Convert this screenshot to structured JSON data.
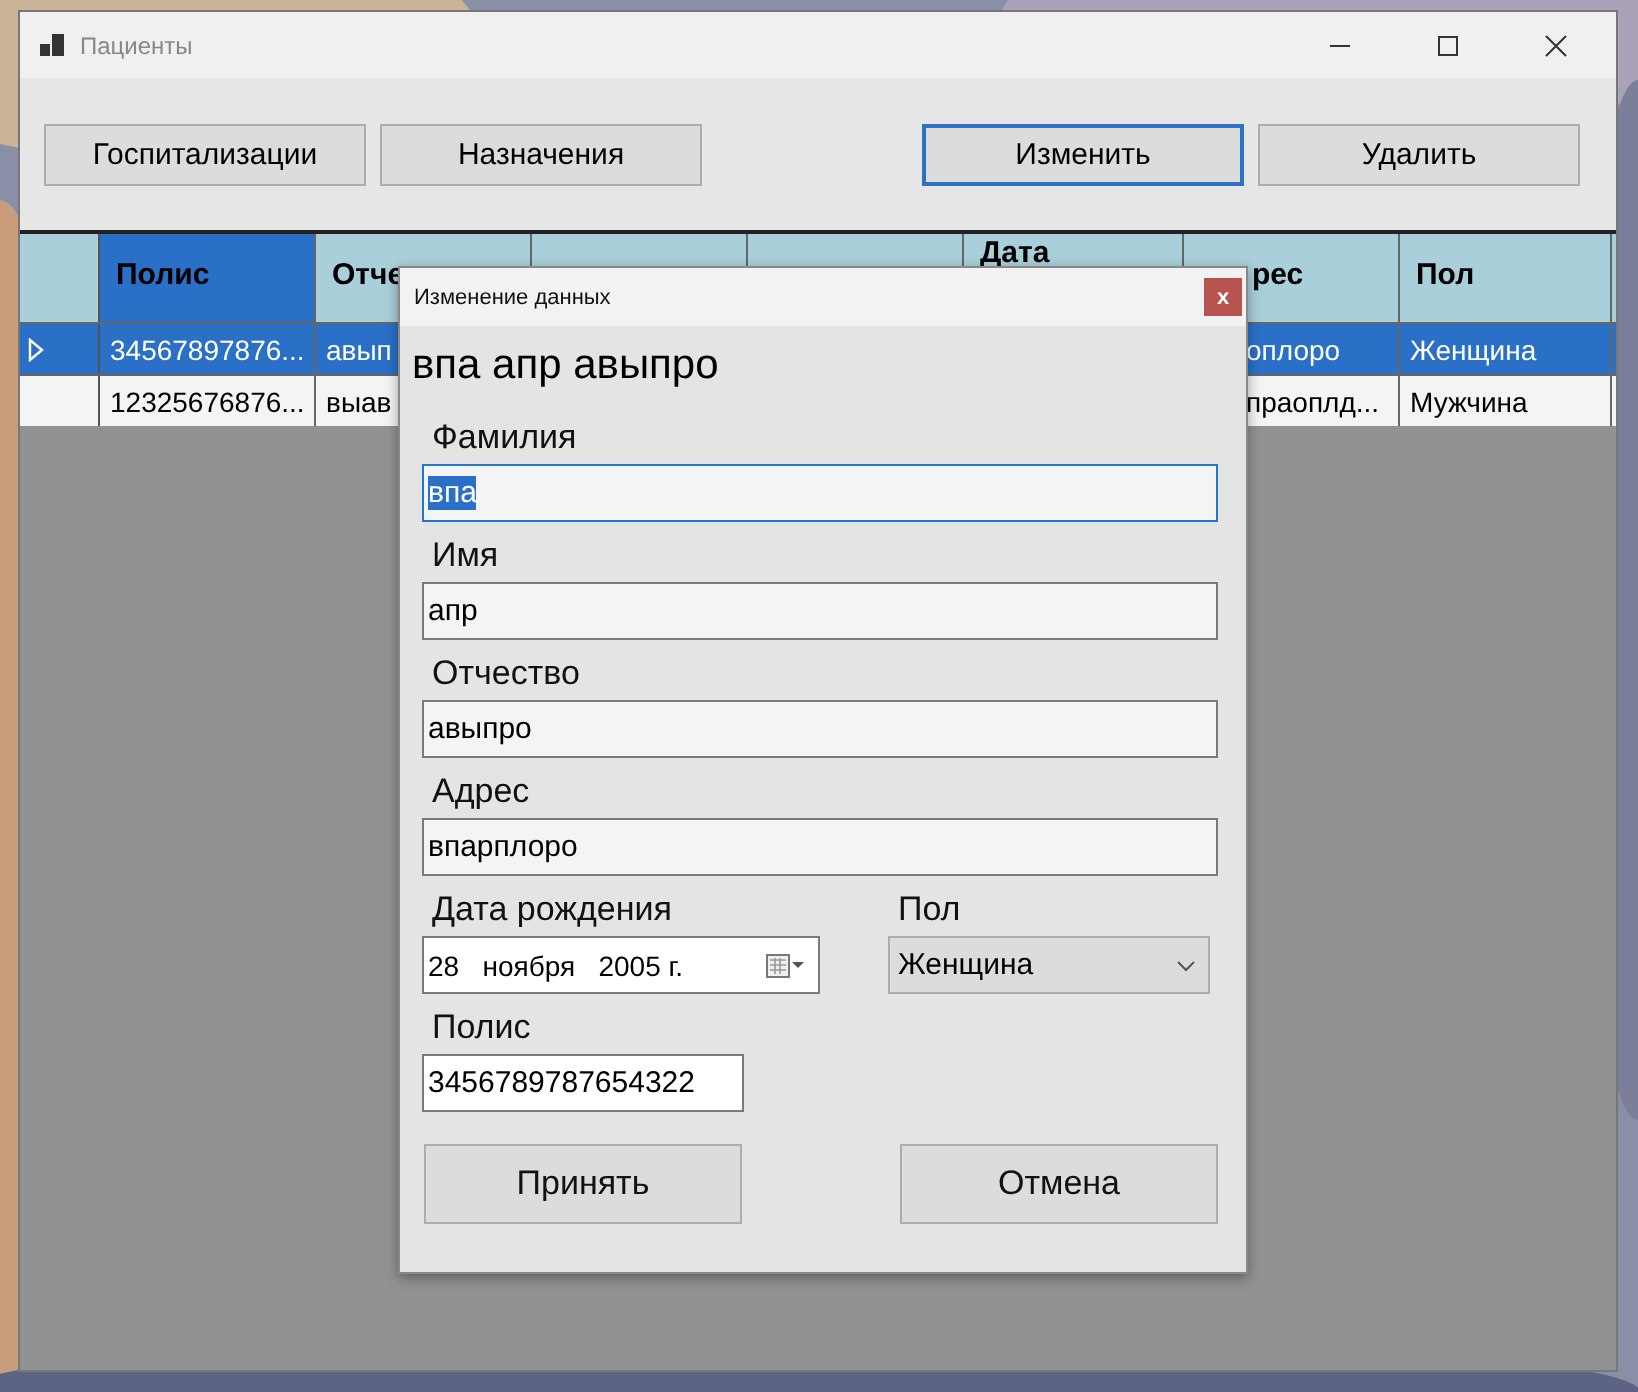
{
  "window": {
    "title": "Пациенты"
  },
  "toolbar": [
    {
      "label": "Госпитализации",
      "focused": false
    },
    {
      "label": "Назначения",
      "focused": false
    },
    {
      "label": "Изменить",
      "focused": true
    },
    {
      "label": "Удалить",
      "focused": false
    }
  ],
  "table": {
    "columns": [
      {
        "label": "Полис"
      },
      {
        "label": "Отче"
      },
      {},
      {},
      {
        "label": "Дата"
      },
      {
        "label": "рес"
      },
      {
        "label": "Пол"
      }
    ],
    "rows": [
      {
        "selected": true,
        "cells": [
          {
            "text": "34567897876..."
          },
          {
            "text": "авып"
          },
          {},
          {},
          {},
          {
            "text": "оплоро"
          },
          {
            "text": "Женщина"
          }
        ]
      },
      {
        "selected": false,
        "cells": [
          {
            "text": "12325676876..."
          },
          {
            "text": "выав"
          },
          {},
          {},
          {},
          {
            "text": "праоплд..."
          },
          {
            "text": "Мужчина"
          }
        ]
      }
    ]
  },
  "dialog": {
    "title": "Изменение данных",
    "close": "x",
    "heading": "впа апр авыпро",
    "fields": [
      {
        "label": "Фамилия",
        "value": "впа",
        "focused": true
      },
      {
        "label": "Имя",
        "value": "апр",
        "focused": false
      },
      {
        "label": "Отчество",
        "value": "авыпро",
        "focused": false
      },
      {
        "label": "Адрес",
        "value": "впарплоро",
        "focused": false
      }
    ],
    "birth_date": {
      "label": "Дата рождения",
      "value": "28   ноября   2005 г."
    },
    "gender": {
      "label": "Пол",
      "value": "Женщина"
    },
    "policy": {
      "label": "Полис",
      "value": "3456789787654322"
    },
    "buttons": [
      "Принять",
      "Отмена"
    ]
  }
}
